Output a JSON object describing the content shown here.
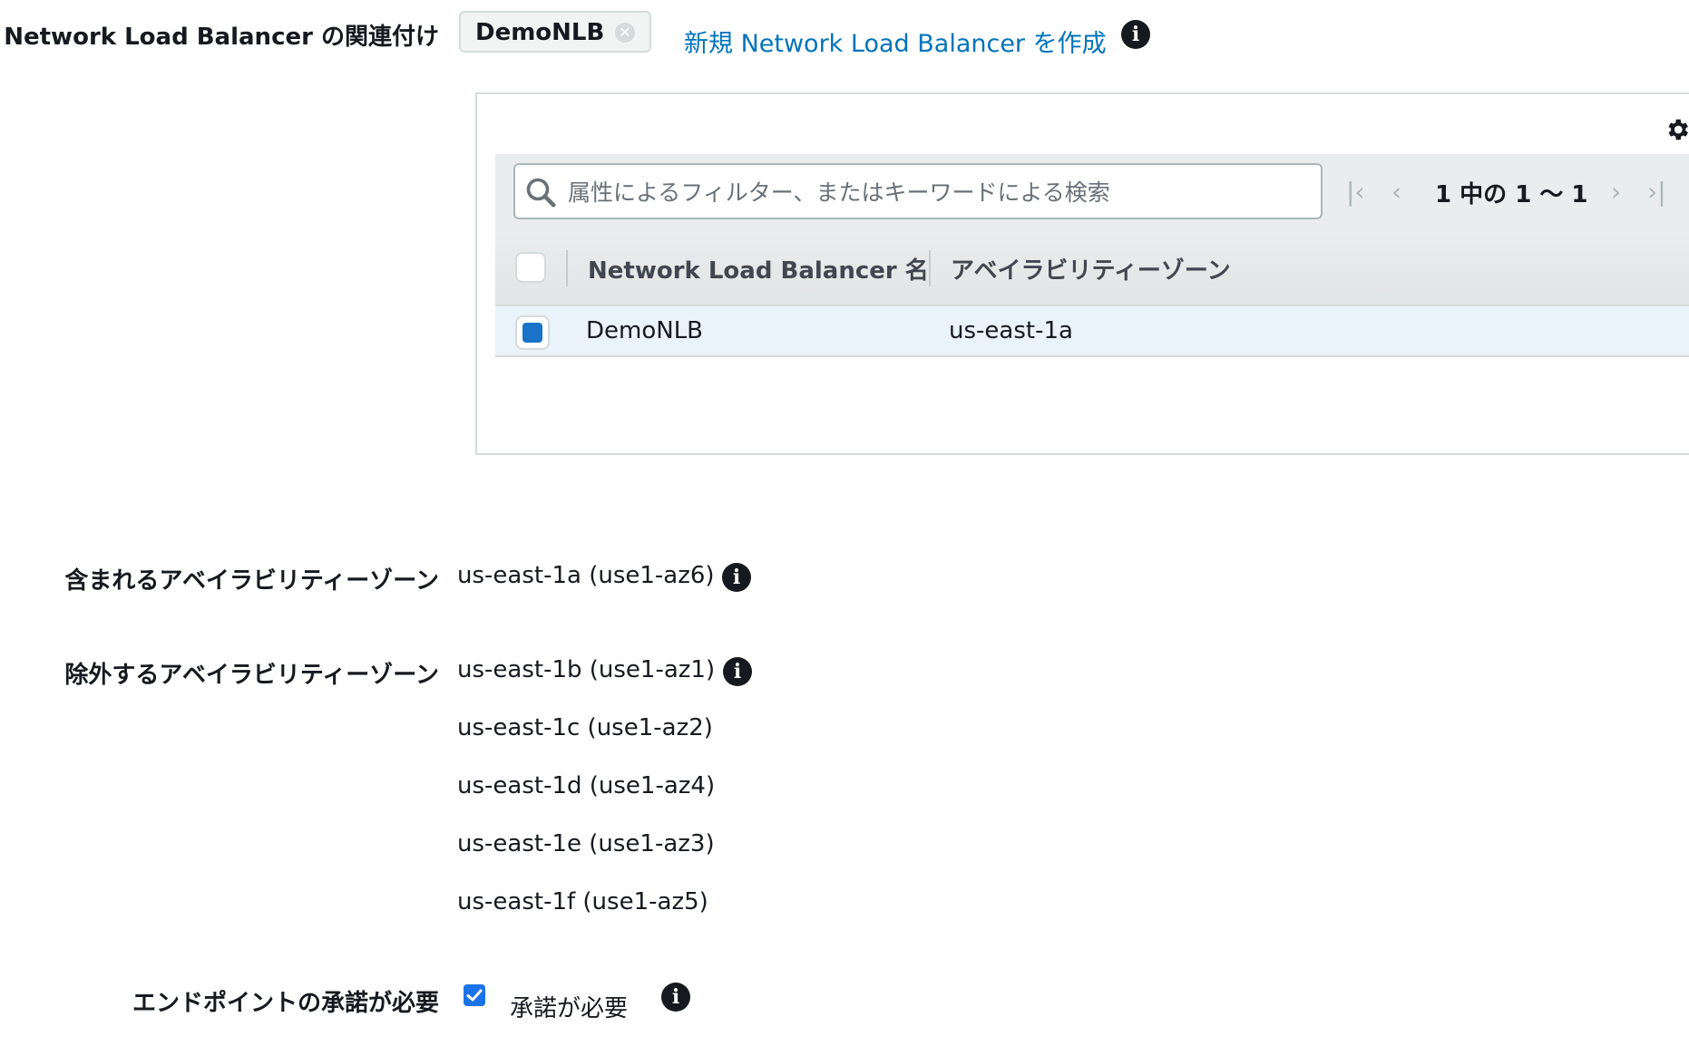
{
  "association": {
    "label": "Network Load Balancer の関連付け",
    "token_label": "DemoNLB",
    "token_remove_icon": "close-circle-icon",
    "create_link": "新規 Network Load Balancer を作成",
    "info_icon": "info-icon"
  },
  "table": {
    "settings_icon": "gear-icon",
    "search": {
      "placeholder": "属性によるフィルター、またはキーワードによる検索",
      "value": ""
    },
    "pagination": {
      "first_icon": "first-page-icon",
      "prev_icon": "prev-page-icon",
      "text": "1 中の 1 〜 1",
      "next_icon": "next-page-icon",
      "last_icon": "last-page-icon"
    },
    "columns": [
      "Network Load Balancer 名",
      "アベイラビリティーゾーン"
    ],
    "rows": [
      {
        "name": "DemoNLB",
        "az": "us-east-1a",
        "selected": true
      }
    ]
  },
  "included_azs": {
    "label": "含まれるアベイラビリティーゾーン",
    "values": [
      "us-east-1a (use1-az6)"
    ]
  },
  "excluded_azs": {
    "label": "除外するアベイラビリティーゾーン",
    "values": [
      "us-east-1b (use1-az1)",
      "us-east-1c (use1-az2)",
      "us-east-1d (use1-az4)",
      "us-east-1e (use1-az3)",
      "us-east-1f (use1-az5)"
    ]
  },
  "acceptance": {
    "label": "エンドポイントの承諾が必要",
    "checkbox_label": "承諾が必要",
    "checked": true
  },
  "colors": {
    "link": "#0073bb",
    "selected_row": "#eaf2fb",
    "checkbox_accent": "#1a73c9",
    "info_icon": "#16191f"
  }
}
